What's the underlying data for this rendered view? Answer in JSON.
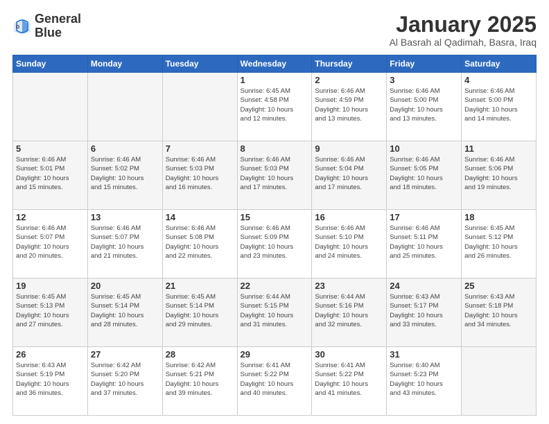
{
  "header": {
    "logo": {
      "general": "General",
      "blue": "Blue"
    },
    "title": "January 2025",
    "location": "Al Basrah al Qadimah, Basra, Iraq"
  },
  "weekdays": [
    "Sunday",
    "Monday",
    "Tuesday",
    "Wednesday",
    "Thursday",
    "Friday",
    "Saturday"
  ],
  "weeks": [
    {
      "shaded": false,
      "days": [
        {
          "num": "",
          "info": "",
          "empty": true
        },
        {
          "num": "",
          "info": "",
          "empty": true
        },
        {
          "num": "",
          "info": "",
          "empty": true
        },
        {
          "num": "1",
          "info": "Sunrise: 6:45 AM\nSunset: 4:58 PM\nDaylight: 10 hours\nand 12 minutes.",
          "empty": false
        },
        {
          "num": "2",
          "info": "Sunrise: 6:46 AM\nSunset: 4:59 PM\nDaylight: 10 hours\nand 13 minutes.",
          "empty": false
        },
        {
          "num": "3",
          "info": "Sunrise: 6:46 AM\nSunset: 5:00 PM\nDaylight: 10 hours\nand 13 minutes.",
          "empty": false
        },
        {
          "num": "4",
          "info": "Sunrise: 6:46 AM\nSunset: 5:00 PM\nDaylight: 10 hours\nand 14 minutes.",
          "empty": false
        }
      ]
    },
    {
      "shaded": true,
      "days": [
        {
          "num": "5",
          "info": "Sunrise: 6:46 AM\nSunset: 5:01 PM\nDaylight: 10 hours\nand 15 minutes.",
          "empty": false
        },
        {
          "num": "6",
          "info": "Sunrise: 6:46 AM\nSunset: 5:02 PM\nDaylight: 10 hours\nand 15 minutes.",
          "empty": false
        },
        {
          "num": "7",
          "info": "Sunrise: 6:46 AM\nSunset: 5:03 PM\nDaylight: 10 hours\nand 16 minutes.",
          "empty": false
        },
        {
          "num": "8",
          "info": "Sunrise: 6:46 AM\nSunset: 5:03 PM\nDaylight: 10 hours\nand 17 minutes.",
          "empty": false
        },
        {
          "num": "9",
          "info": "Sunrise: 6:46 AM\nSunset: 5:04 PM\nDaylight: 10 hours\nand 17 minutes.",
          "empty": false
        },
        {
          "num": "10",
          "info": "Sunrise: 6:46 AM\nSunset: 5:05 PM\nDaylight: 10 hours\nand 18 minutes.",
          "empty": false
        },
        {
          "num": "11",
          "info": "Sunrise: 6:46 AM\nSunset: 5:06 PM\nDaylight: 10 hours\nand 19 minutes.",
          "empty": false
        }
      ]
    },
    {
      "shaded": false,
      "days": [
        {
          "num": "12",
          "info": "Sunrise: 6:46 AM\nSunset: 5:07 PM\nDaylight: 10 hours\nand 20 minutes.",
          "empty": false
        },
        {
          "num": "13",
          "info": "Sunrise: 6:46 AM\nSunset: 5:07 PM\nDaylight: 10 hours\nand 21 minutes.",
          "empty": false
        },
        {
          "num": "14",
          "info": "Sunrise: 6:46 AM\nSunset: 5:08 PM\nDaylight: 10 hours\nand 22 minutes.",
          "empty": false
        },
        {
          "num": "15",
          "info": "Sunrise: 6:46 AM\nSunset: 5:09 PM\nDaylight: 10 hours\nand 23 minutes.",
          "empty": false
        },
        {
          "num": "16",
          "info": "Sunrise: 6:46 AM\nSunset: 5:10 PM\nDaylight: 10 hours\nand 24 minutes.",
          "empty": false
        },
        {
          "num": "17",
          "info": "Sunrise: 6:46 AM\nSunset: 5:11 PM\nDaylight: 10 hours\nand 25 minutes.",
          "empty": false
        },
        {
          "num": "18",
          "info": "Sunrise: 6:45 AM\nSunset: 5:12 PM\nDaylight: 10 hours\nand 26 minutes.",
          "empty": false
        }
      ]
    },
    {
      "shaded": true,
      "days": [
        {
          "num": "19",
          "info": "Sunrise: 6:45 AM\nSunset: 5:13 PM\nDaylight: 10 hours\nand 27 minutes.",
          "empty": false
        },
        {
          "num": "20",
          "info": "Sunrise: 6:45 AM\nSunset: 5:14 PM\nDaylight: 10 hours\nand 28 minutes.",
          "empty": false
        },
        {
          "num": "21",
          "info": "Sunrise: 6:45 AM\nSunset: 5:14 PM\nDaylight: 10 hours\nand 29 minutes.",
          "empty": false
        },
        {
          "num": "22",
          "info": "Sunrise: 6:44 AM\nSunset: 5:15 PM\nDaylight: 10 hours\nand 31 minutes.",
          "empty": false
        },
        {
          "num": "23",
          "info": "Sunrise: 6:44 AM\nSunset: 5:16 PM\nDaylight: 10 hours\nand 32 minutes.",
          "empty": false
        },
        {
          "num": "24",
          "info": "Sunrise: 6:43 AM\nSunset: 5:17 PM\nDaylight: 10 hours\nand 33 minutes.",
          "empty": false
        },
        {
          "num": "25",
          "info": "Sunrise: 6:43 AM\nSunset: 5:18 PM\nDaylight: 10 hours\nand 34 minutes.",
          "empty": false
        }
      ]
    },
    {
      "shaded": false,
      "days": [
        {
          "num": "26",
          "info": "Sunrise: 6:43 AM\nSunset: 5:19 PM\nDaylight: 10 hours\nand 36 minutes.",
          "empty": false
        },
        {
          "num": "27",
          "info": "Sunrise: 6:42 AM\nSunset: 5:20 PM\nDaylight: 10 hours\nand 37 minutes.",
          "empty": false
        },
        {
          "num": "28",
          "info": "Sunrise: 6:42 AM\nSunset: 5:21 PM\nDaylight: 10 hours\nand 39 minutes.",
          "empty": false
        },
        {
          "num": "29",
          "info": "Sunrise: 6:41 AM\nSunset: 5:22 PM\nDaylight: 10 hours\nand 40 minutes.",
          "empty": false
        },
        {
          "num": "30",
          "info": "Sunrise: 6:41 AM\nSunset: 5:22 PM\nDaylight: 10 hours\nand 41 minutes.",
          "empty": false
        },
        {
          "num": "31",
          "info": "Sunrise: 6:40 AM\nSunset: 5:23 PM\nDaylight: 10 hours\nand 43 minutes.",
          "empty": false
        },
        {
          "num": "",
          "info": "",
          "empty": true
        }
      ]
    }
  ]
}
